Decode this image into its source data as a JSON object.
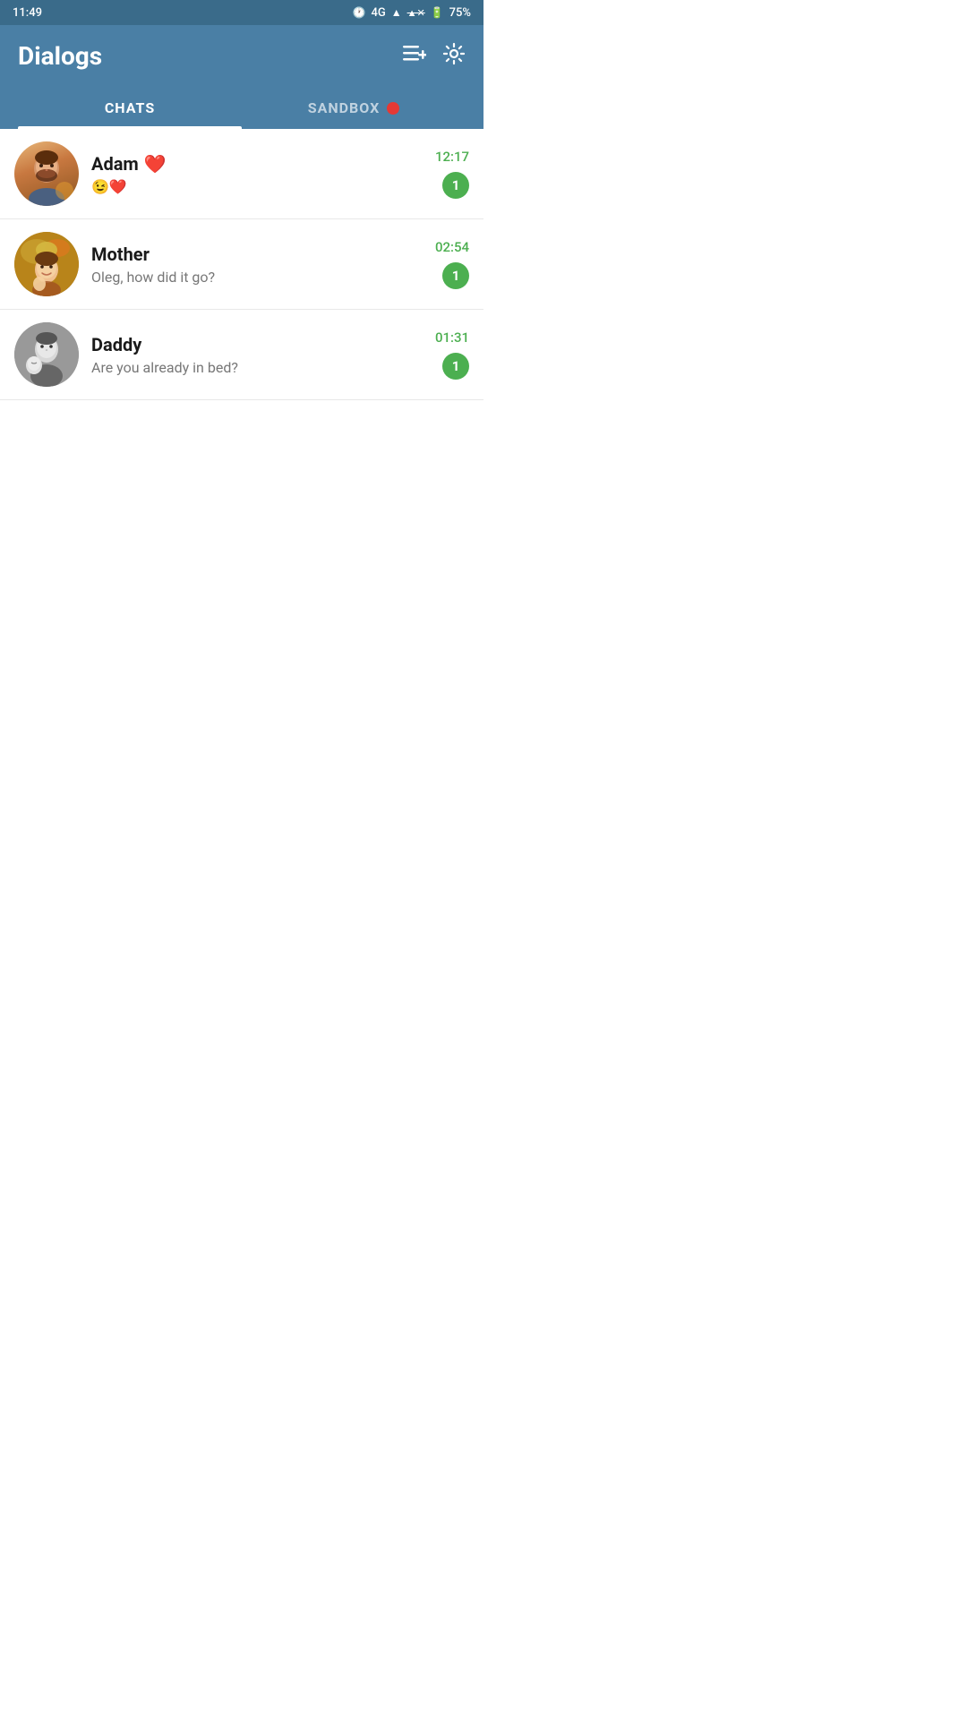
{
  "statusBar": {
    "time": "11:49",
    "battery": "75%",
    "network": "4G"
  },
  "header": {
    "title": "Dialogs",
    "newChatIcon": "≡+",
    "settingsIcon": "⚙"
  },
  "tabs": [
    {
      "id": "chats",
      "label": "CHATS",
      "active": true
    },
    {
      "id": "sandbox",
      "label": "SANDBOX",
      "active": false,
      "hasDot": true
    }
  ],
  "chats": [
    {
      "id": "adam",
      "name": "Adam",
      "nameEmoji": "❤️",
      "preview": "😉❤️",
      "time": "12:17",
      "unread": 1,
      "avatarType": "adam"
    },
    {
      "id": "mother",
      "name": "Mother",
      "nameEmoji": "",
      "preview": "Oleg, how did it go?",
      "time": "02:54",
      "unread": 1,
      "avatarType": "mother"
    },
    {
      "id": "daddy",
      "name": "Daddy",
      "nameEmoji": "",
      "preview": "Are you already in bed?",
      "time": "01:31",
      "unread": 1,
      "avatarType": "daddy"
    }
  ],
  "colors": {
    "headerBg": "#4a7fa5",
    "activeTab": "#ffffff",
    "inactiveTab": "rgba(255,255,255,0.6)",
    "unreadBadge": "#4caf50",
    "sandboxDot": "#e53935"
  }
}
